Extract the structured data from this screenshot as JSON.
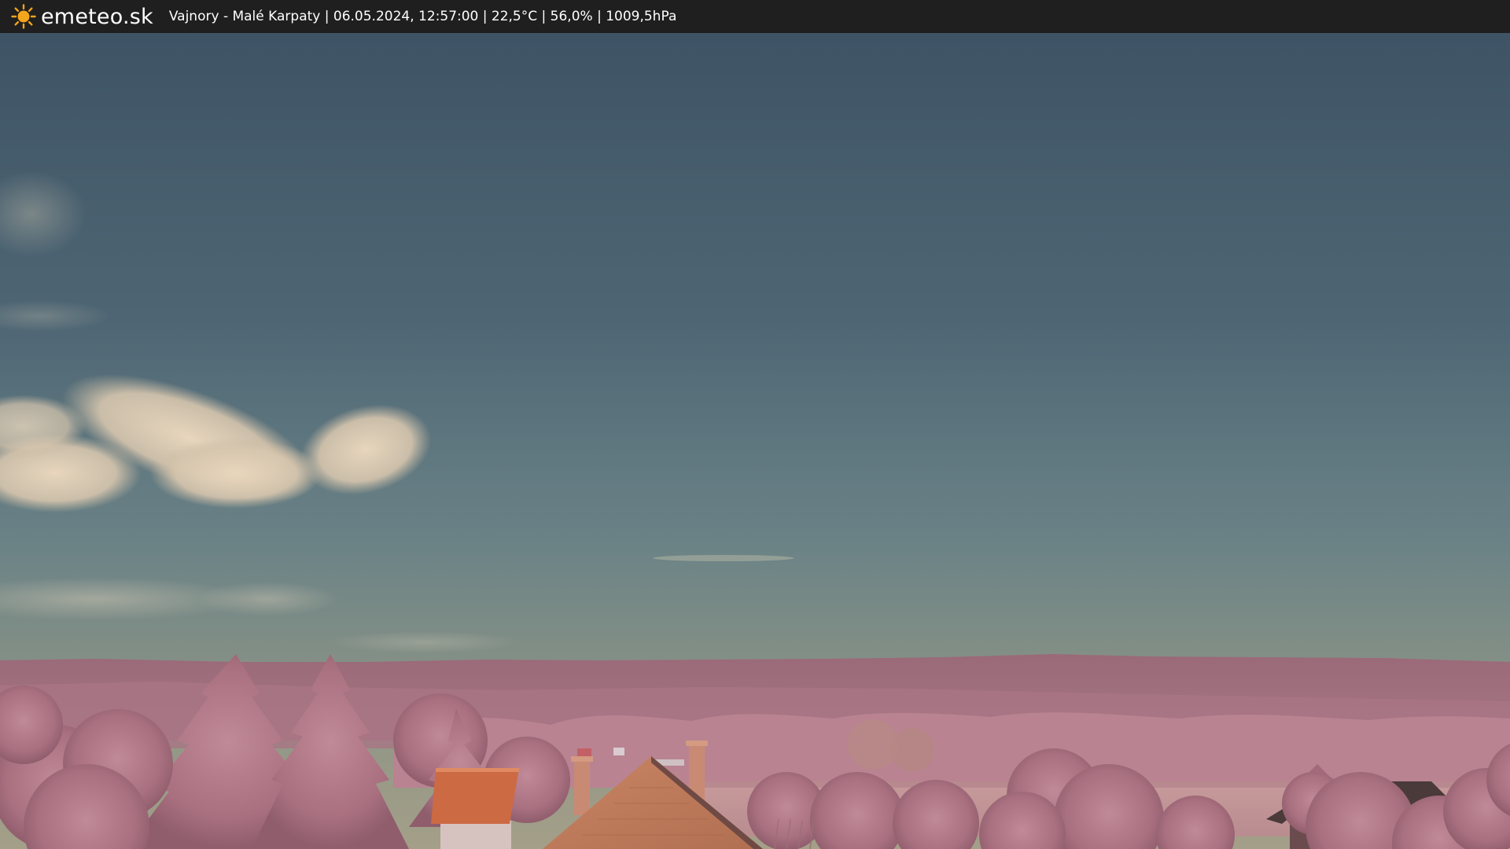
{
  "header": {
    "brand": "emeteo.sk",
    "info": "Vajnory - Malé Karpaty | 06.05.2024, 12:57:00 | 22,5°C | 56,0% | 1009,5hPa"
  },
  "colors": {
    "bar_bg": "#1f1f1f",
    "sun": "#f3a51c",
    "sky_top": "#3f5566",
    "sky_mid": "#566f79",
    "sky_horizon": "#96957f",
    "hills": "#a2707f",
    "foliage": "#c08a97",
    "roof": "#cc6a44"
  },
  "icons": {
    "logo": "sun-icon"
  }
}
